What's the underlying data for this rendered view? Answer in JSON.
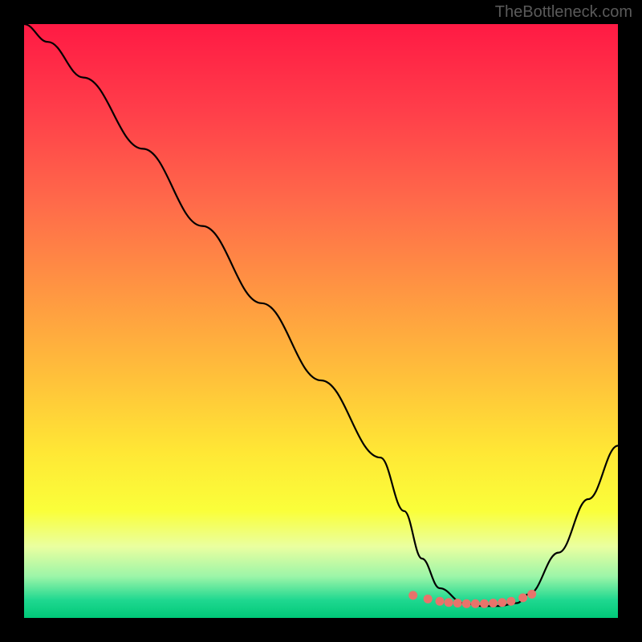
{
  "attribution": "TheBottleneck.com",
  "chart_data": {
    "type": "line",
    "title": "",
    "xlabel": "",
    "ylabel": "",
    "xlim": [
      0,
      100
    ],
    "ylim": [
      0,
      100
    ],
    "series": [
      {
        "name": "bottleneck-curve",
        "x": [
          0,
          4,
          10,
          20,
          30,
          40,
          50,
          60,
          64,
          67,
          70,
          74,
          77,
          80,
          83,
          85,
          90,
          95,
          100
        ],
        "y": [
          100,
          97,
          91,
          79,
          66,
          53,
          40,
          27,
          18,
          10,
          5,
          2.5,
          2,
          2,
          2.5,
          4,
          11,
          20,
          29
        ]
      }
    ],
    "markers": {
      "name": "optimal-range-dots",
      "x": [
        65.5,
        68,
        70,
        71.5,
        73,
        74.5,
        76,
        77.5,
        79,
        80.5,
        82,
        84,
        85.5
      ],
      "y": [
        3.8,
        3.2,
        2.8,
        2.6,
        2.5,
        2.4,
        2.4,
        2.4,
        2.5,
        2.6,
        2.8,
        3.4,
        4.0
      ]
    },
    "gradient_stops": [
      {
        "offset": 0.0,
        "color": "#ff1a44"
      },
      {
        "offset": 0.15,
        "color": "#ff3f4a"
      },
      {
        "offset": 0.3,
        "color": "#ff6a4a"
      },
      {
        "offset": 0.45,
        "color": "#ff9642"
      },
      {
        "offset": 0.6,
        "color": "#ffc23a"
      },
      {
        "offset": 0.72,
        "color": "#ffe735"
      },
      {
        "offset": 0.82,
        "color": "#faff3a"
      },
      {
        "offset": 0.88,
        "color": "#eaffa0"
      },
      {
        "offset": 0.93,
        "color": "#9cf5a8"
      },
      {
        "offset": 0.97,
        "color": "#1fd890"
      },
      {
        "offset": 1.0,
        "color": "#00c878"
      }
    ],
    "marker_color": "#e8736b",
    "curve_color": "#000000"
  }
}
